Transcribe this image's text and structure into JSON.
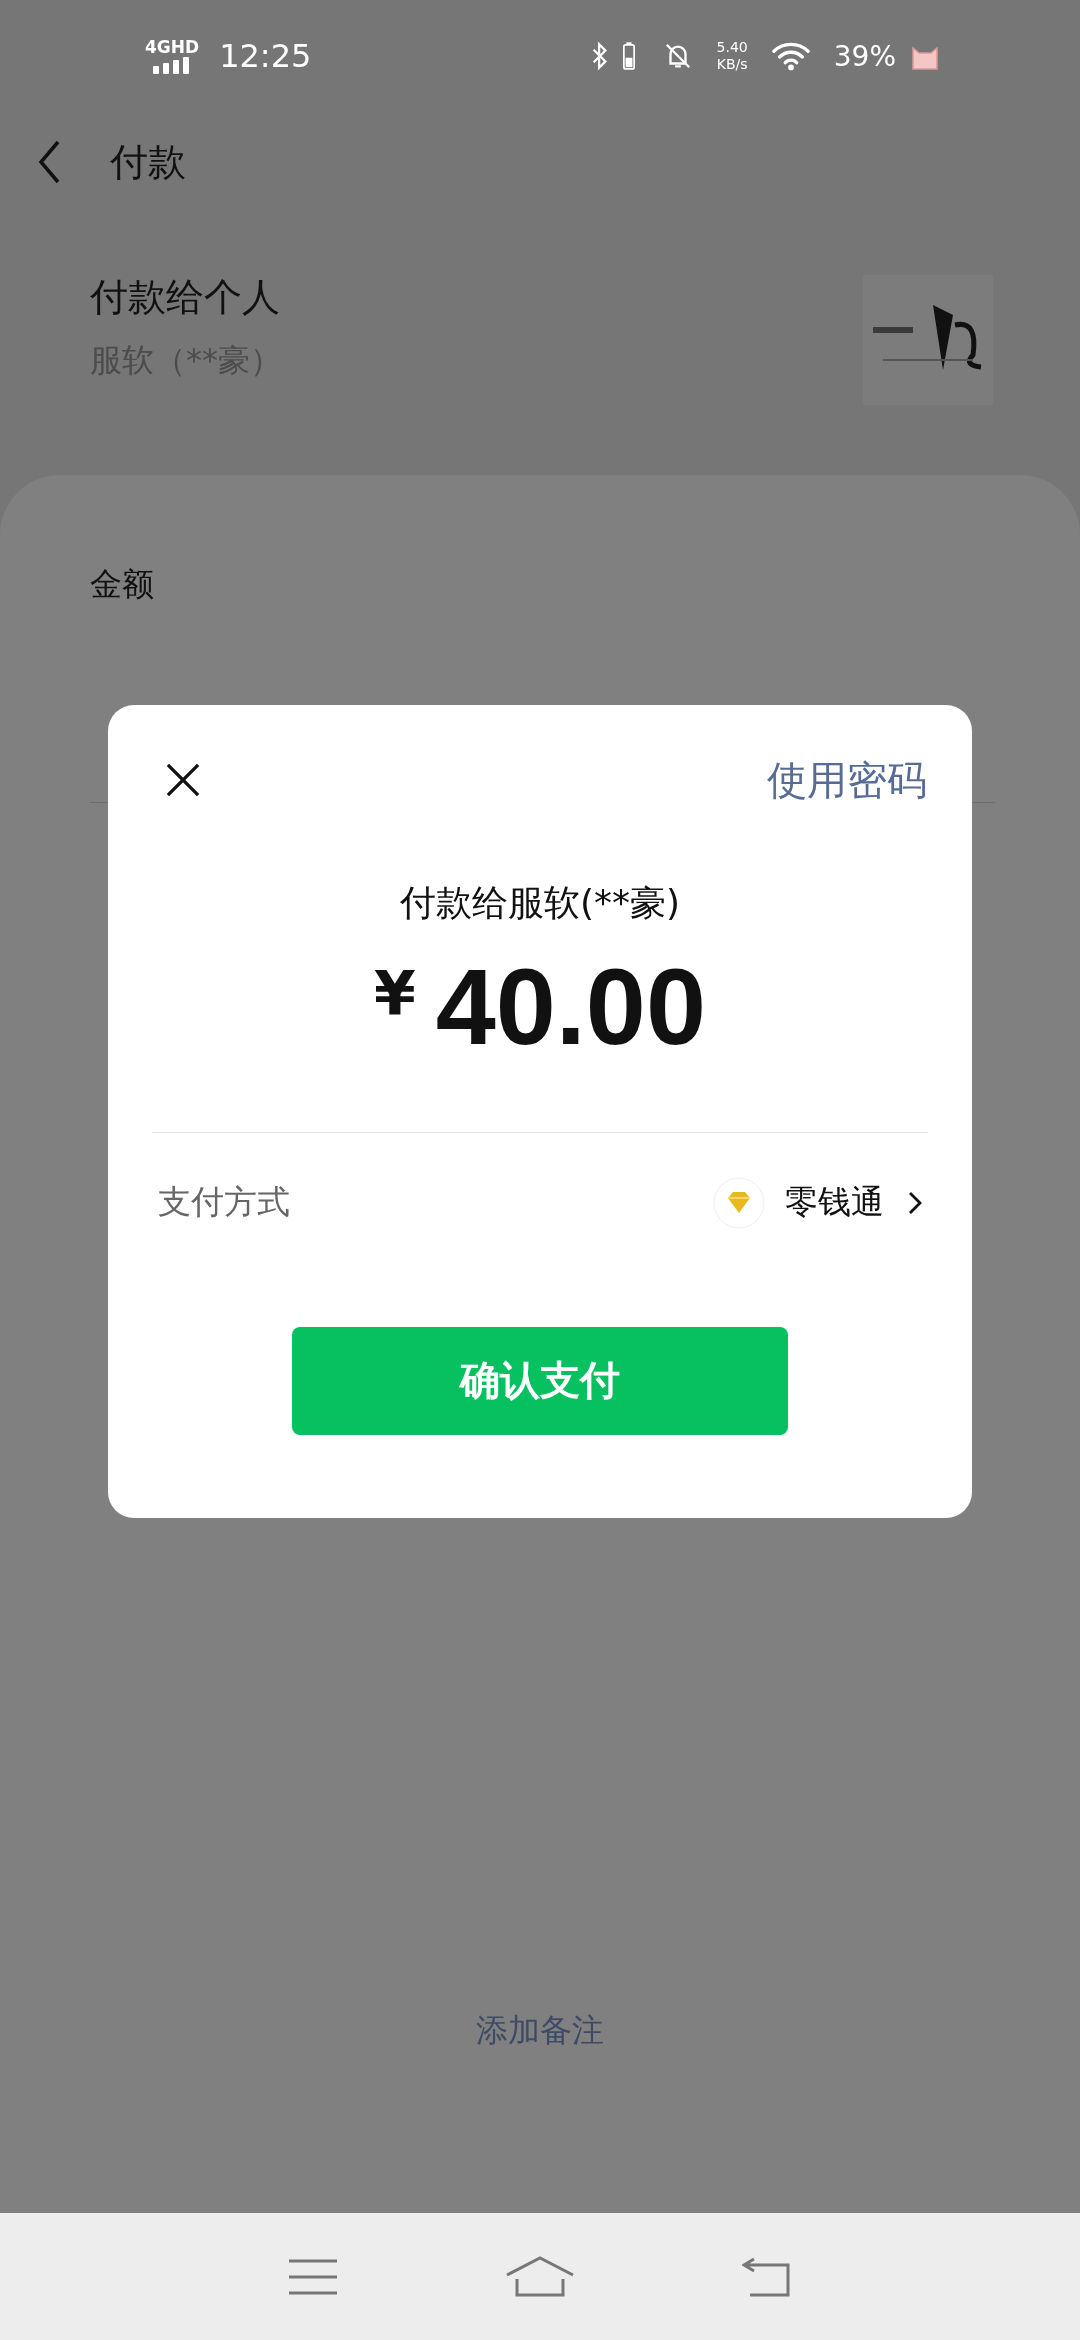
{
  "status_bar": {
    "network": "4GHD",
    "time": "12:25",
    "speed_value": "5.40",
    "speed_unit": "KB/s",
    "battery": "39%"
  },
  "header": {
    "title": "付款"
  },
  "payee": {
    "title": "付款给个人",
    "name": "服软（**豪）"
  },
  "amount": {
    "label": "金额"
  },
  "remark_link": "添加备注",
  "dialog": {
    "password_link": "使用密码",
    "payee_line": "付款给服软(**豪)",
    "currency": "¥",
    "amount": "40.00",
    "method_label": "支付方式",
    "method": "零钱通",
    "confirm": "确认支付"
  }
}
